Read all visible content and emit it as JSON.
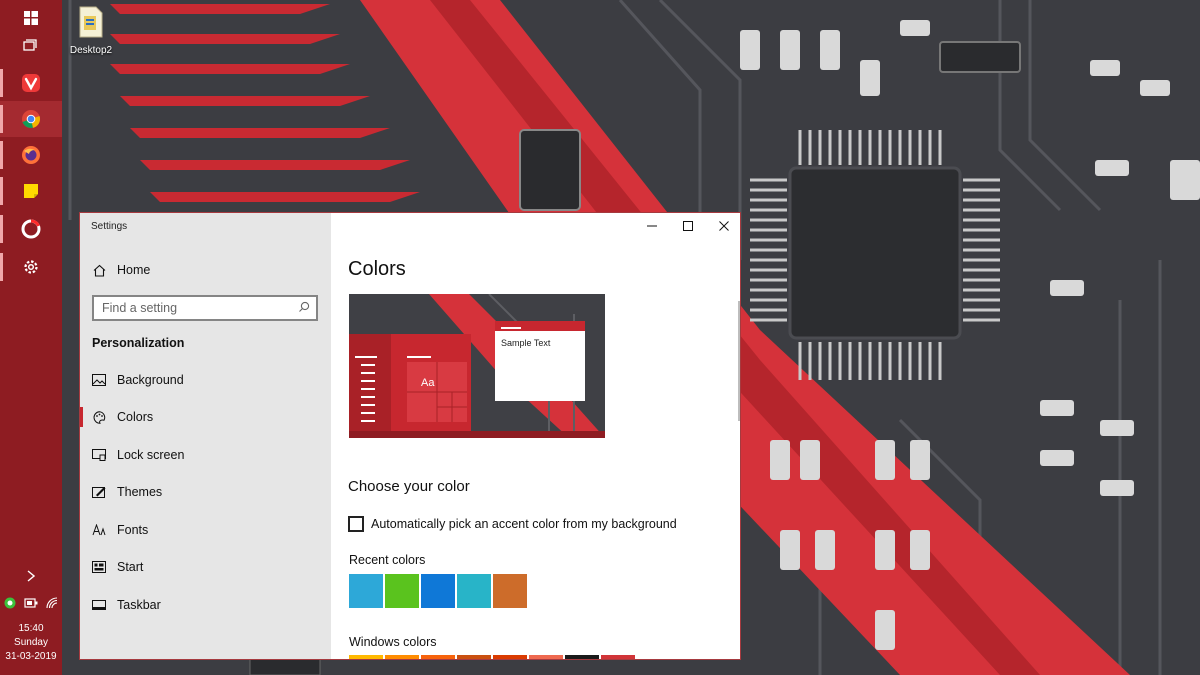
{
  "desktop": {
    "icon_label": "Desktop2"
  },
  "taskbar": {
    "apps": [
      "start-icon",
      "task-view-icon",
      "vivaldi-icon",
      "chrome-icon",
      "firefox-icon",
      "sticky-notes-icon",
      "opera-icon",
      "settings-icon"
    ],
    "clock": {
      "time": "15:40",
      "day": "Sunday",
      "date": "31-03-2019"
    }
  },
  "window": {
    "title": "Settings",
    "controls": [
      "minimize-icon",
      "maximize-icon",
      "close-icon"
    ]
  },
  "nav": {
    "home": "Home",
    "search_placeholder": "Find a setting",
    "section": "Personalization",
    "items": [
      {
        "label": "Background",
        "icon": "background-icon"
      },
      {
        "label": "Colors",
        "icon": "palette-icon",
        "selected": true
      },
      {
        "label": "Lock screen",
        "icon": "lock-screen-icon"
      },
      {
        "label": "Themes",
        "icon": "themes-icon"
      },
      {
        "label": "Fonts",
        "icon": "fonts-icon"
      },
      {
        "label": "Start",
        "icon": "start-icon"
      },
      {
        "label": "Taskbar",
        "icon": "taskbar-icon"
      }
    ]
  },
  "content": {
    "title": "Colors",
    "preview": {
      "sample_text": "Sample Text",
      "tile_text": "Aa"
    },
    "choose_heading": "Choose your color",
    "auto_accent_label": "Automatically pick an accent color from my background",
    "auto_accent_checked": false,
    "recent_label": "Recent colors",
    "recent_colors": [
      "#2da8d8",
      "#5ac31e",
      "#0f78d7",
      "#28b4c8",
      "#cd6c2a"
    ],
    "windows_label": "Windows colors",
    "windows_colors": [
      "#ffb900",
      "#ff8c00",
      "#f7630c",
      "#ca5010",
      "#da3b01",
      "#ef6950",
      "#1a1a1a",
      "#d13438"
    ]
  },
  "theme": {
    "accent": "#c7272f",
    "taskbar": "#8e1c22"
  }
}
